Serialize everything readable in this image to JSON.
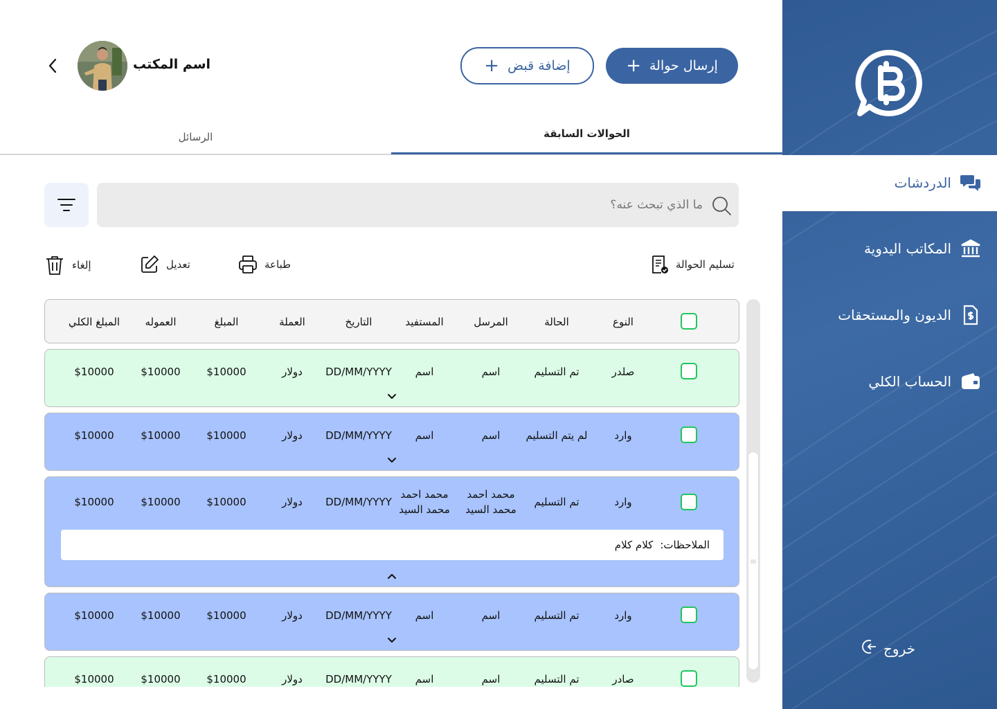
{
  "header": {
    "office_name": "اسم المكتب",
    "send_transfer_label": "إرسال حوالة",
    "add_receipt_label": "إضافة قبض"
  },
  "tabs": [
    {
      "label": "الحوالات السابقة",
      "active": true
    },
    {
      "label": "الرسائل",
      "active": false
    }
  ],
  "search": {
    "placeholder": "ما الذي تبحث عنه؟"
  },
  "toolbar": {
    "deliver": "تسليم الحوالة",
    "print": "طباعة",
    "edit": "تعديل",
    "cancel": "إلغاء"
  },
  "table": {
    "columns": [
      "النوع",
      "الحالة",
      "المرسل",
      "المستفيد",
      "التاريخ",
      "العملة",
      "المبلغ",
      "العموله",
      "المبلغ الكلي"
    ],
    "rows": [
      {
        "type": "صلدر",
        "status": "تم التسليم",
        "sender": "اسم",
        "beneficiary": "اسم",
        "date": "DD/MM/YYYY",
        "currency": "دولار",
        "amount": "$10000",
        "commission": "$10000",
        "total": "$10000"
      },
      {
        "type": "وارد",
        "status": "لم يتم التسليم",
        "sender": "اسم",
        "beneficiary": "اسم",
        "date": "DD/MM/YYYY",
        "currency": "دولار",
        "amount": "$10000",
        "commission": "$10000",
        "total": "$10000"
      },
      {
        "type": "وارد",
        "status": "تم التسليم",
        "sender_line1": "محمد احمد",
        "sender_line2": "محمد السيد",
        "beneficiary_line1": "محمد احمد",
        "beneficiary_line2": "محمد السيد",
        "date": "DD/MM/YYYY",
        "currency": "دولار",
        "amount": "$10000",
        "commission": "$10000",
        "total": "$10000",
        "notes_label": "الملاحظات:",
        "notes_value": "كلام كلام"
      },
      {
        "type": "وارد",
        "status": "تم التسليم",
        "sender": "اسم",
        "beneficiary": "اسم",
        "date": "DD/MM/YYYY",
        "currency": "دولار",
        "amount": "$10000",
        "commission": "$10000",
        "total": "$10000"
      },
      {
        "type": "صادر",
        "status": "تم التسليم",
        "sender": "اسم",
        "beneficiary": "اسم",
        "date": "DD/MM/YYYY",
        "currency": "دولار",
        "amount": "$10000",
        "commission": "$10000",
        "total": "$10000"
      }
    ]
  },
  "sidebar": {
    "items": [
      {
        "label": "الدردشات",
        "icon": "chat-icon",
        "active": true
      },
      {
        "label": "المكاتب اليدوية",
        "icon": "bank-icon",
        "active": false
      },
      {
        "label": "الديون والمستحقات",
        "icon": "money-document-icon",
        "active": false
      },
      {
        "label": "الحساب الكلي",
        "icon": "wallet-icon",
        "active": false
      }
    ],
    "logout_label": "خروج"
  },
  "colors": {
    "primary": "#3b64a3",
    "row_green": "#dcfce7",
    "row_blue": "#a8c3fd",
    "checkbox": "#22c55e"
  }
}
